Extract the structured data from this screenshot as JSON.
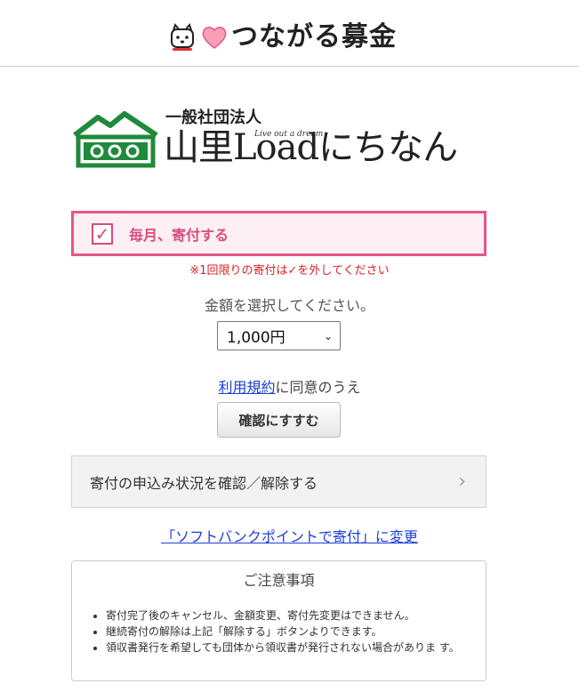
{
  "header": {
    "brand_name": "つながる募金"
  },
  "organization": {
    "type_label": "一般社団法人",
    "tagline": "Live out a dream",
    "name": "山里Loadにちなん"
  },
  "monthly": {
    "label": "毎月、寄付する",
    "checked": true,
    "note": "※1回限りの寄付は✓を外してください"
  },
  "amount": {
    "prompt": "金額を選択してください。",
    "selected": "1,000円"
  },
  "terms": {
    "link_text": "利用規約",
    "suffix": "に同意のうえ"
  },
  "confirm_button": "確認にすすむ",
  "status_row": "寄付の申込み状況を確認／解除する",
  "switch_link": "「ソフトバンクポイントで寄付」に変更",
  "notice": {
    "title": "ご注意事項",
    "items": [
      "寄付完了後のキャンセル、金額変更、寄付先変更はできません。",
      "継続寄付の解除は上記「解除する」ボタンよりできます。",
      "領収書発行を希望しても団体から領収書が発行されない場合がありま す。"
    ]
  },
  "colors": {
    "accent_pink": "#e5578a",
    "link_blue": "#1a3fd8",
    "note_red": "#d92323",
    "logo_green": "#1f8a3a"
  }
}
